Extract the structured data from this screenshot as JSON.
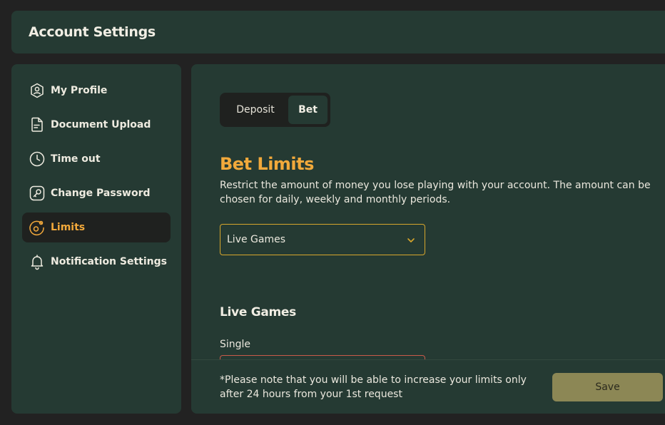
{
  "header": {
    "title": "Account Settings"
  },
  "sidebar": {
    "items": [
      {
        "label": "My Profile",
        "icon": "profile-icon",
        "active": false
      },
      {
        "label": "Document Upload",
        "icon": "document-icon",
        "active": false
      },
      {
        "label": "Time out",
        "icon": "clock-icon",
        "active": false
      },
      {
        "label": "Change Password",
        "icon": "key-icon",
        "active": false
      },
      {
        "label": "Limits",
        "icon": "limits-icon",
        "active": true
      },
      {
        "label": "Notification Settings",
        "icon": "bell-icon",
        "active": false
      }
    ]
  },
  "main": {
    "tabs": [
      {
        "label": "Deposit",
        "active": false
      },
      {
        "label": "Bet",
        "active": true
      }
    ],
    "title": "Bet Limits",
    "description": "Restrict the amount of money you lose playing with your account. The amount can be chosen for daily, weekly and monthly periods.",
    "select": {
      "value": "Live Games"
    },
    "section_title": "Live Games",
    "field_label": "Single"
  },
  "footer": {
    "note": "*Please note that you will be able to increase your limits only after 24 hours from your 1st request",
    "save_label": "Save"
  },
  "colors": {
    "accent": "#f2a93b",
    "panel": "#253a33",
    "background": "#222222",
    "save_button": "#8c8755",
    "select_border": "#d7a62c"
  }
}
